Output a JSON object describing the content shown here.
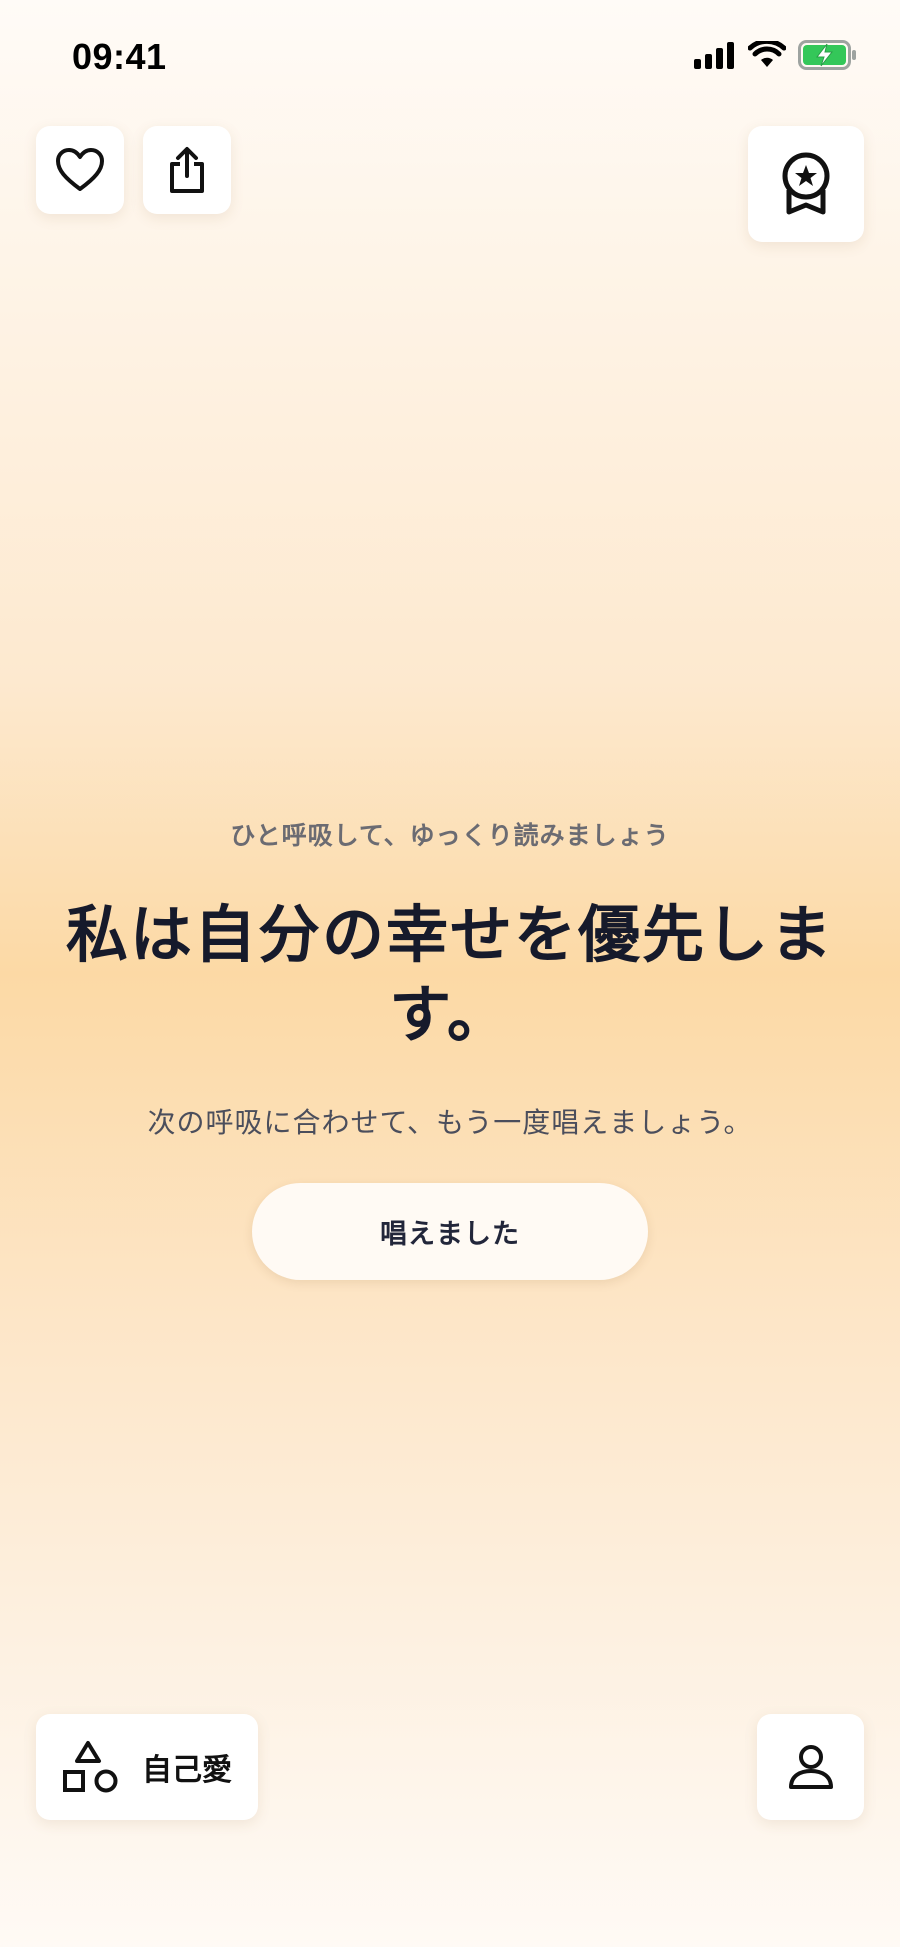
{
  "status_bar": {
    "time": "09:41",
    "icons": [
      "signal-icon",
      "wifi-icon",
      "battery-charging-icon"
    ]
  },
  "toolbar": {
    "favorite_icon": "heart-icon",
    "share_icon": "share-icon",
    "badge_icon": "award-ribbon-icon"
  },
  "main": {
    "prompt": "ひと呼吸して、ゆっくり読みましょう",
    "affirmation": "私は自分の幸せを優先します。",
    "instruction": "次の呼吸に合わせて、もう一度唱えましょう。",
    "done_button": "唱えました"
  },
  "bottom_bar": {
    "category_icon": "shapes-icon",
    "category_label": "自己愛",
    "profile_icon": "person-icon"
  },
  "colors": {
    "accent_gradient_mid": "#fcd9a5",
    "text_primary": "#161a2b",
    "battery_green": "#34c759"
  }
}
